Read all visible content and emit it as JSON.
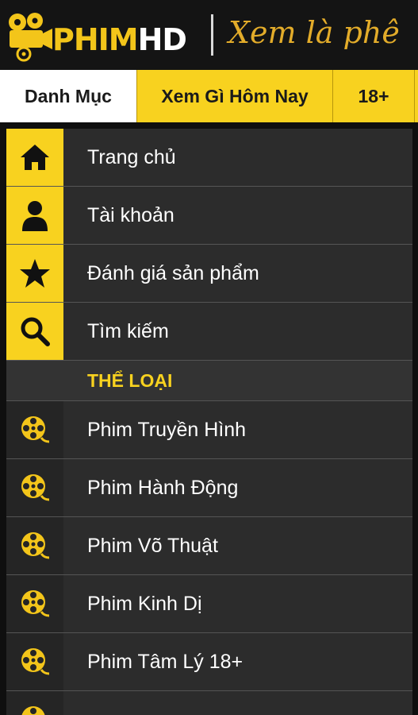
{
  "header": {
    "logo_main": "PHIM",
    "logo_suffix": "HD",
    "slogan": "Xem là phê"
  },
  "tabs": [
    {
      "label": "Danh Mục",
      "active": true
    },
    {
      "label": "Xem Gì Hôm Nay",
      "active": false
    },
    {
      "label": "18+",
      "active": false
    }
  ],
  "menu": {
    "main_items": [
      {
        "label": "Trang chủ",
        "icon": "home-icon"
      },
      {
        "label": "Tài khoản",
        "icon": "user-icon"
      },
      {
        "label": "Đánh giá sản phẩm",
        "icon": "star-icon"
      },
      {
        "label": "Tìm kiếm",
        "icon": "search-icon"
      }
    ],
    "section_title": "THỂ LOẠI",
    "genres": [
      {
        "label": "Phim Truyền Hình",
        "icon": "film-reel-icon"
      },
      {
        "label": "Phim Hành Động",
        "icon": "film-reel-icon"
      },
      {
        "label": "Phim Võ Thuật",
        "icon": "film-reel-icon"
      },
      {
        "label": "Phim Kinh Dị",
        "icon": "film-reel-icon"
      },
      {
        "label": "Phim Tâm Lý 18+",
        "icon": "film-reel-icon"
      }
    ]
  },
  "colors": {
    "accent": "#f8d21f",
    "background": "#2c2c2c",
    "header": "#141414",
    "slogan": "#e3ac2a"
  }
}
